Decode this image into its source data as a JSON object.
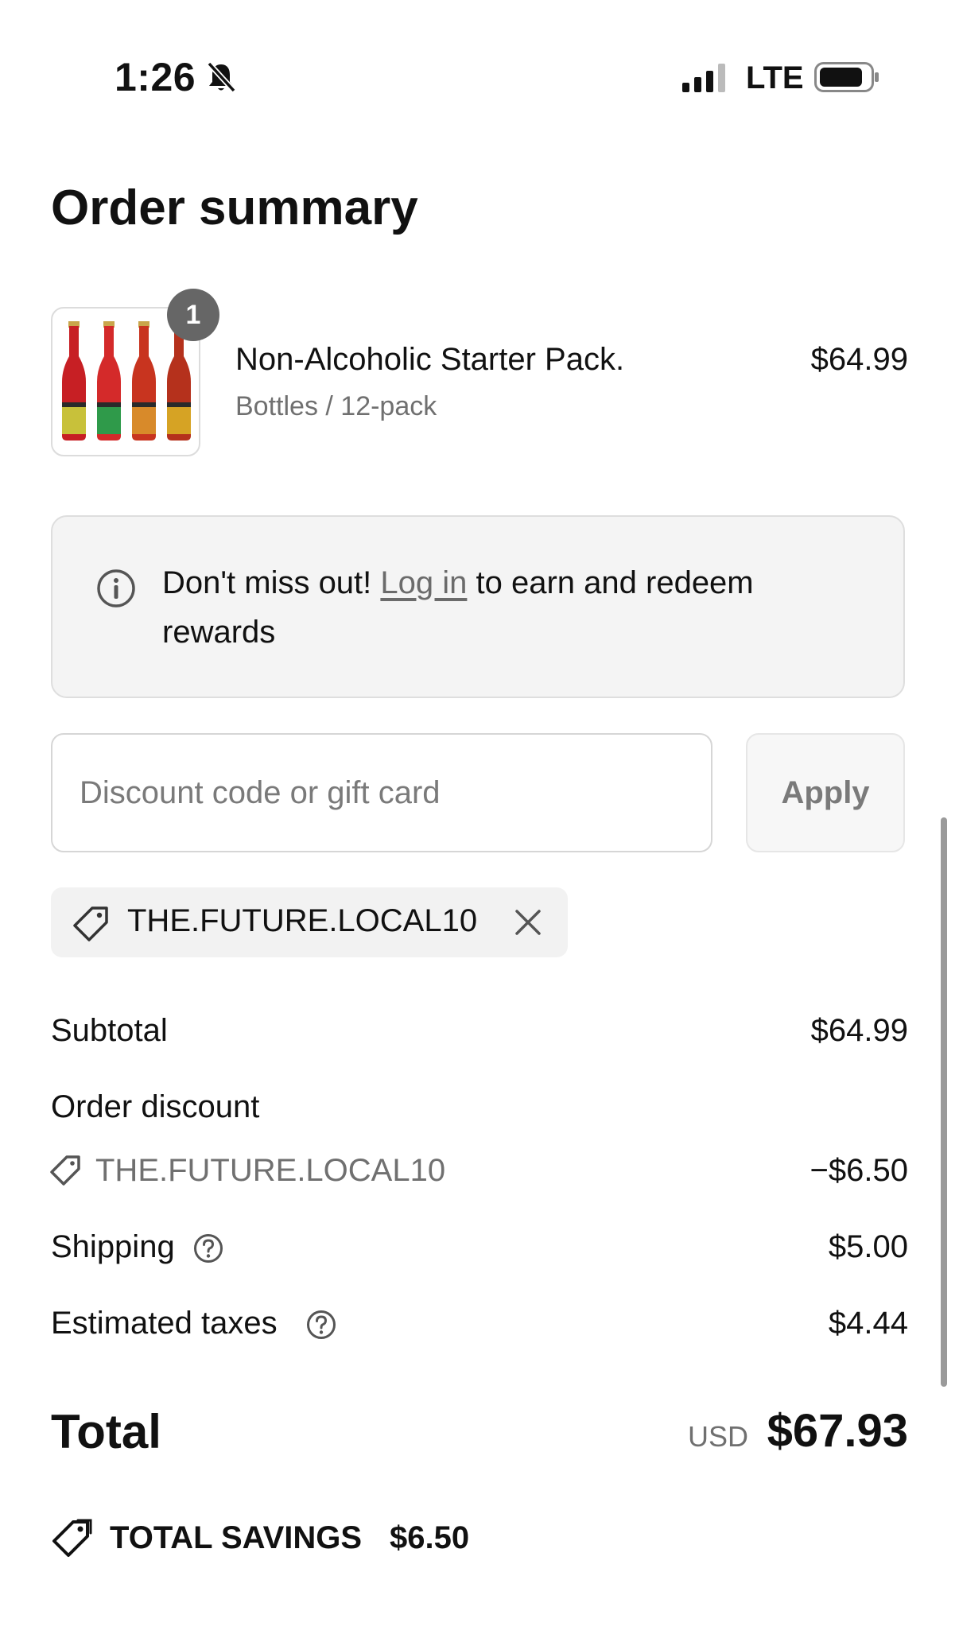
{
  "status_bar": {
    "time": "1:26",
    "network": "LTE",
    "icons": [
      "bell-slash-icon",
      "signal-icon",
      "battery-icon"
    ]
  },
  "page_title": "Order summary",
  "product": {
    "quantity": "1",
    "name": "Non-Alcoholic Starter Pack.",
    "variant": "Bottles / 12-pack",
    "price": "$64.99",
    "bottle_colors": [
      "#c71f24",
      "#d42a2a",
      "#c8341f",
      "#b5311c"
    ]
  },
  "rewards": {
    "prefix": "Don't miss out! ",
    "link": "Log in",
    "suffix": " to earn and redeem rewards"
  },
  "discount": {
    "placeholder": "Discount code or gift card",
    "value": "",
    "apply_label": "Apply",
    "applied_code": "THE.FUTURE.LOCAL10"
  },
  "summary": {
    "subtotal_label": "Subtotal",
    "subtotal_value": "$64.99",
    "order_discount_label": "Order discount",
    "discount_code": "THE.FUTURE.LOCAL10",
    "discount_value": "−$6.50",
    "shipping_label": "Shipping",
    "shipping_value": "$5.00",
    "taxes_label": "Estimated taxes",
    "taxes_value": "$4.44",
    "total_label": "Total",
    "currency": "USD",
    "total_value": "$67.93",
    "savings_label": "TOTAL SAVINGS",
    "savings_value": "$6.50"
  },
  "colors": {
    "text": "#111111",
    "muted": "#707070",
    "panel": "#f4f4f4",
    "badge": "#666666"
  }
}
